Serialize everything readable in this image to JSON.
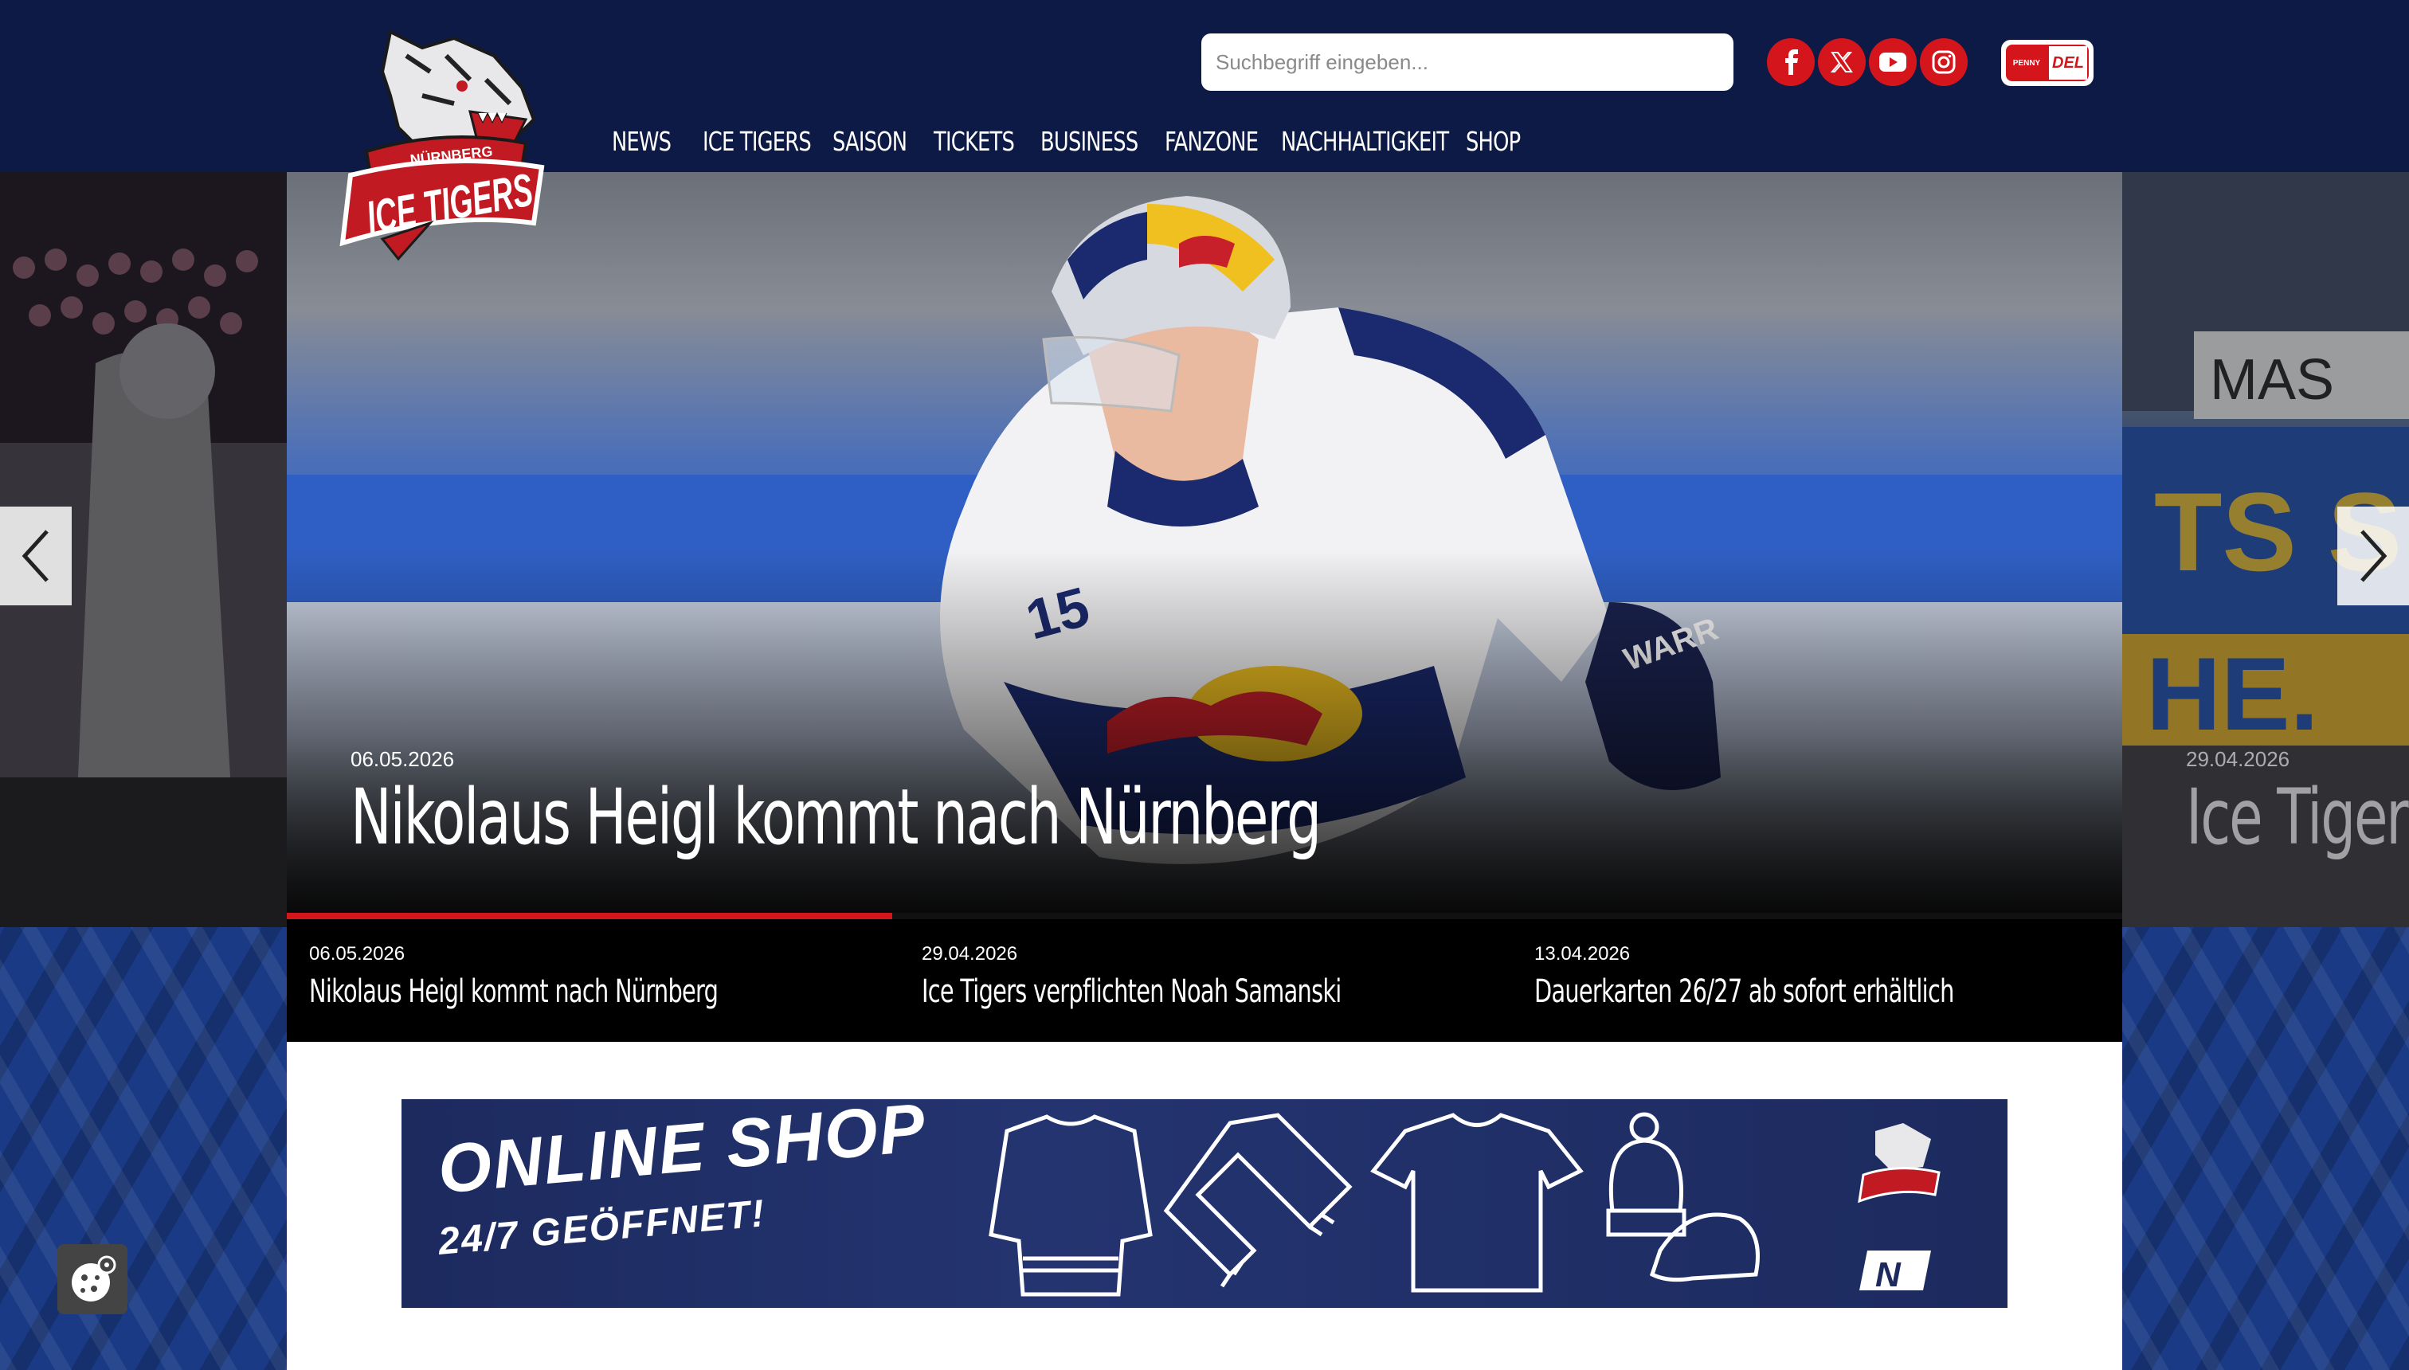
{
  "header": {
    "brand_top": "NÜRNBERG",
    "brand_name": "ICE TIGERS",
    "search_placeholder": "Suchbegriff eingeben...",
    "social": [
      "facebook-icon",
      "x-icon",
      "youtube-icon",
      "instagram-icon"
    ],
    "league_badge_left": "PENNY",
    "league_badge_right": "DEL"
  },
  "nav": [
    "NEWS",
    "ICE TIGERS",
    "SAISON",
    "TICKETS",
    "BUSINESS",
    "FANZONE",
    "NACHHALTIGKEIT",
    "SHOP"
  ],
  "hero": {
    "date": "06.05.2026",
    "title": "Nikolaus Heigl kommt nach Nürnberg",
    "next_date": "29.04.2026",
    "next_title": "Ice Tigers",
    "progress": 0.33
  },
  "news": [
    {
      "date": "06.05.2026",
      "title": "Nikolaus Heigl kommt nach Nürnberg"
    },
    {
      "date": "29.04.2026",
      "title": "Ice Tigers verpflichten Noah Samanski"
    },
    {
      "date": "13.04.2026",
      "title": "Dauerkarten 26/27 ab sofort erhältlich"
    }
  ],
  "shop": {
    "title": "ONLINE SHOP",
    "subtitle": "24/7 GEÖFFNET!"
  },
  "colors": {
    "header_bg": "#0d1a45",
    "accent_red": "#d4161c",
    "pattern_blue": "#1a3a85"
  }
}
